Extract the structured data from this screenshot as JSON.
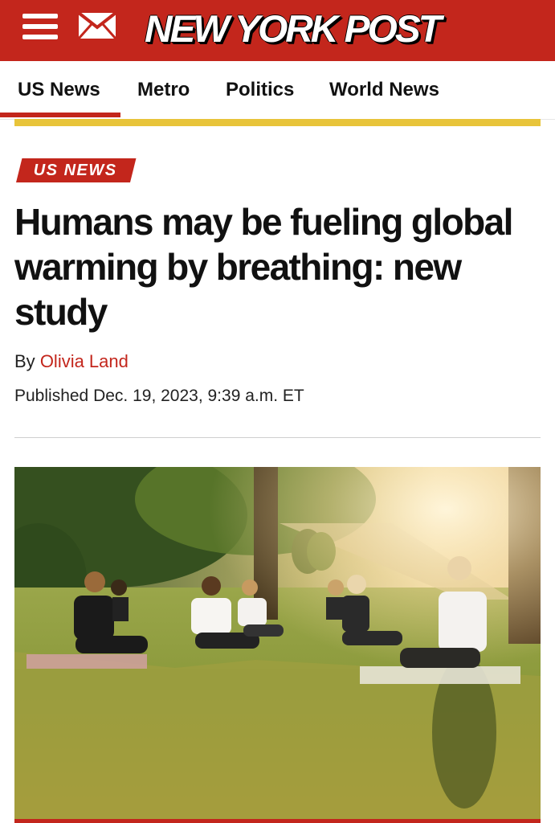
{
  "header": {
    "logo_text": "NEW YORK POST",
    "menu_icon": "hamburger-menu-icon",
    "mail_icon": "envelope-icon",
    "brand_color": "#c3261c"
  },
  "nav": {
    "items": [
      {
        "label": "US News",
        "active": true
      },
      {
        "label": "Metro",
        "active": false
      },
      {
        "label": "Politics",
        "active": false
      },
      {
        "label": "World News",
        "active": false
      }
    ],
    "accent_color": "#e8c43a"
  },
  "article": {
    "section": "US NEWS",
    "headline": "Humans may be fueling global warming by breathing: new study",
    "byline_prefix": "By",
    "author": "Olivia Land",
    "published": "Published Dec. 19, 2023, 9:39 a.m. ET"
  }
}
